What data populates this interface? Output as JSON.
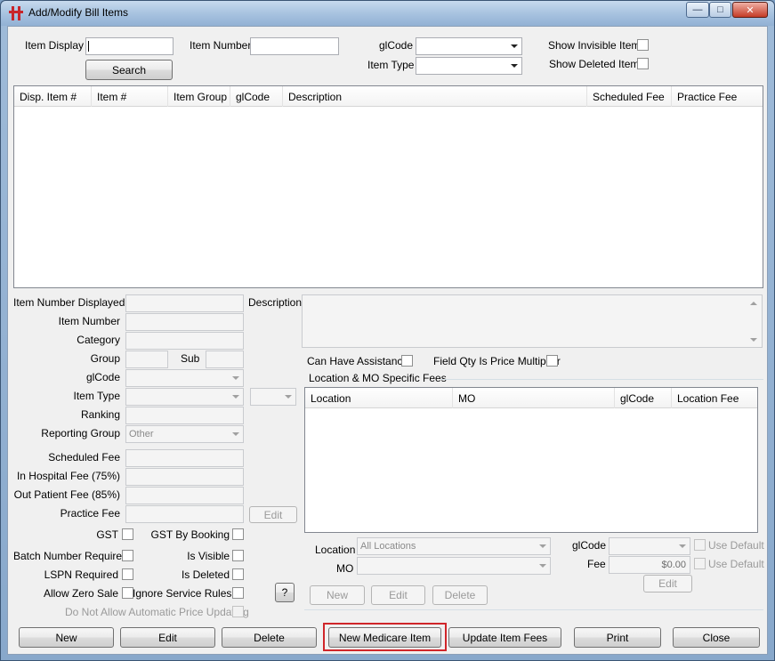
{
  "window": {
    "title": "Add/Modify Bill Items"
  },
  "search": {
    "item_display_label": "Item Display",
    "item_display_value": "",
    "item_number_label": "Item Number",
    "item_number_value": "",
    "glcode_label": "glCode",
    "glcode_value": "",
    "item_type_label": "Item Type",
    "item_type_value": "",
    "search_button": "Search",
    "show_invisible_label": "Show Invisible Items",
    "show_deleted_label": "Show Deleted Items"
  },
  "items_table": {
    "columns": [
      "Disp. Item #",
      "Item #",
      "Item Group",
      "glCode",
      "Description",
      "Scheduled Fee",
      "Practice Fee"
    ],
    "rows": []
  },
  "details": {
    "item_number_displayed_label": "Item Number Displayed",
    "item_number_label": "Item Number",
    "category_label": "Category",
    "group_label": "Group",
    "sub_label": "Sub",
    "glcode_label": "glCode",
    "item_type_label": "Item Type",
    "ranking_label": "Ranking",
    "reporting_group_label": "Reporting Group",
    "reporting_group_value": "Other",
    "scheduled_fee_label": "Scheduled Fee",
    "in_hospital_fee_label": "In Hospital Fee (75%)",
    "out_patient_fee_label": "Out Patient Fee (85%)",
    "practice_fee_label": "Practice Fee",
    "practice_fee_edit_button": "Edit",
    "description_label": "Description",
    "gst_label": "GST",
    "gst_by_booking_label": "GST By Booking",
    "batch_number_required_label": "Batch Number Required",
    "is_visible_label": "Is Visible",
    "lspn_required_label": "LSPN Required",
    "is_deleted_label": "Is Deleted",
    "allow_zero_sale_label": "Allow Zero Sale",
    "ignore_service_rules_label": "Ignore Service Rules",
    "help_button": "?",
    "no_auto_price_label": "Do Not Allow Automatic Price Updating",
    "can_have_assistance_label": "Can Have Assistance",
    "field_qty_multiplier_label": "Field Qty Is Price Multiplier"
  },
  "location_fees": {
    "group_title": "Location & MO Specific Fees",
    "columns": [
      "Location",
      "MO",
      "glCode",
      "Location Fee"
    ],
    "rows": [],
    "location_label": "Location",
    "location_value": "All Locations",
    "mo_label": "MO",
    "mo_value": "",
    "glcode_label": "glCode",
    "glcode_value": "",
    "fee_label": "Fee",
    "fee_value": "$0.00",
    "use_default_label_1": "Use Default",
    "use_default_label_2": "Use Default",
    "new_button": "New",
    "edit_button": "Edit",
    "delete_button": "Delete",
    "fee_edit_button": "Edit"
  },
  "footer": {
    "new_button": "New",
    "edit_button": "Edit",
    "delete_button": "Delete",
    "new_medicare_button": "New Medicare Item",
    "update_fees_button": "Update Item Fees",
    "print_button": "Print",
    "close_button": "Close"
  },
  "colors": {
    "highlight": "#d0262a",
    "app_icon": "#c8242a"
  }
}
